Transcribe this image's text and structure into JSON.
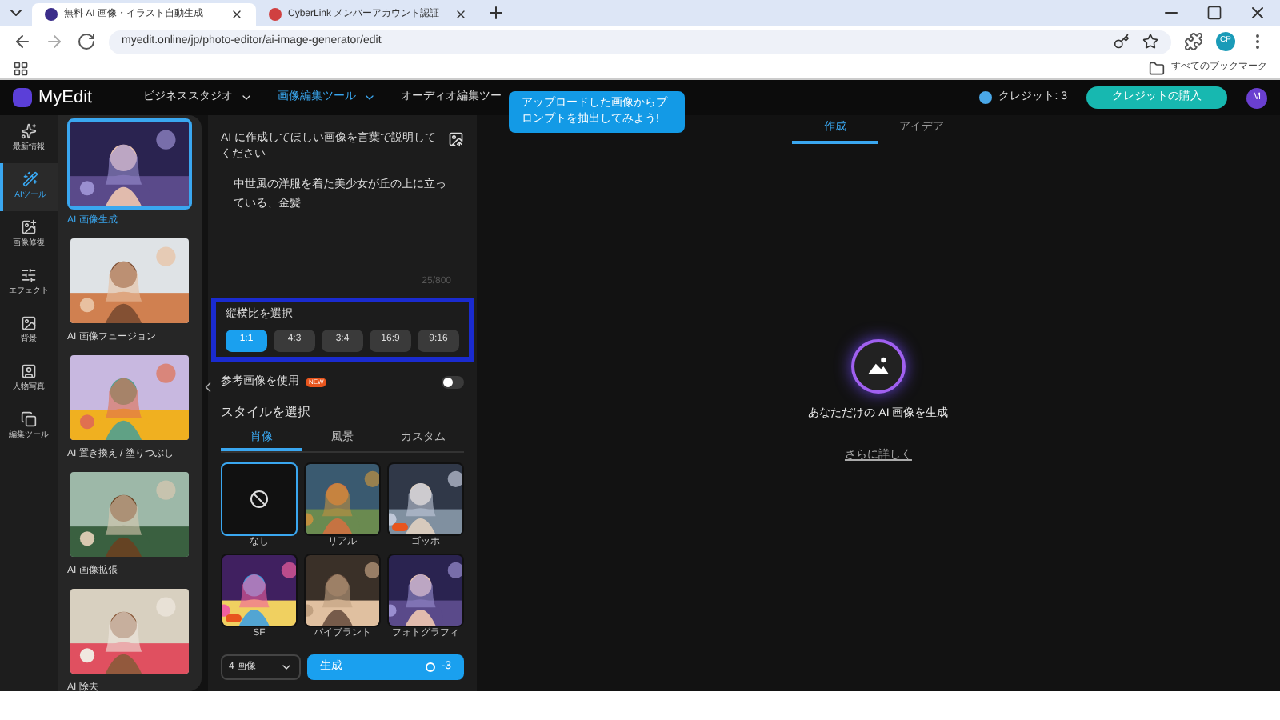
{
  "browser": {
    "tabs": [
      {
        "title": "無料 AI 画像・イラスト自動生成",
        "selected": true
      },
      {
        "title": "CyberLink メンバーアカウント認証",
        "selected": false
      }
    ],
    "url": "myedit.online/jp/photo-editor/ai-image-generator/edit",
    "bookmarks": "すべてのブックマーク",
    "profile": "CP"
  },
  "header": {
    "logo": "MyEdit",
    "nav": [
      {
        "label": "ビジネススタジオ",
        "selected": false
      },
      {
        "label": "画像編集ツール",
        "selected": true
      },
      {
        "label": "オーディオ編集ツー",
        "selected": false
      }
    ],
    "tooltip": "アップロードした画像からプロンプトを抽出してみよう!",
    "credits": "クレジット: 3",
    "buy": "クレジットの購入",
    "avatar": "M"
  },
  "rail": [
    {
      "label": "最新情報",
      "selected": false
    },
    {
      "label": "AIツール",
      "selected": true
    },
    {
      "label": "画像修復",
      "selected": false
    },
    {
      "label": "エフェクト",
      "selected": false
    },
    {
      "label": "背景",
      "selected": false
    },
    {
      "label": "人物写真",
      "selected": false
    },
    {
      "label": "編集ツール",
      "selected": false
    }
  ],
  "tools": [
    {
      "label": "AI 画像生成",
      "selected": true,
      "kind": "picture"
    },
    {
      "label": "AI 画像フュージョン",
      "selected": false,
      "kind": "picture"
    },
    {
      "label": "AI 置き換え / 塗りつぶし",
      "selected": false,
      "kind": "picture"
    },
    {
      "label": "AI 画像拡張",
      "selected": false,
      "kind": "picture"
    },
    {
      "label": "AI 除去",
      "selected": false,
      "kind": "picture"
    }
  ],
  "editor": {
    "prompt_label": "AI に作成してほしい画像を言葉で説明してください",
    "prompt": "中世風の洋服を着た美少女が丘の上に立っている、金髪",
    "count": "25/800",
    "ratio_label": "縦横比を選択",
    "ratios": [
      {
        "label": "1:1",
        "selected": true
      },
      {
        "label": "4:3",
        "selected": false
      },
      {
        "label": "3:4",
        "selected": false
      },
      {
        "label": "16:9",
        "selected": false
      },
      {
        "label": "9:16",
        "selected": false
      }
    ],
    "reference": {
      "label": "参考画像を使用",
      "badge": "NEW",
      "on": false
    },
    "style_label": "スタイルを選択",
    "style_tabs": [
      {
        "label": "肖像",
        "selected": true
      },
      {
        "label": "風景",
        "selected": false
      },
      {
        "label": "カスタム",
        "selected": false
      }
    ],
    "styles": [
      {
        "label": "なし",
        "kind": "none",
        "selected": true,
        "new": false
      },
      {
        "label": "リアル",
        "kind": "picture",
        "selected": false,
        "new": false
      },
      {
        "label": "ゴッホ",
        "kind": "picture",
        "selected": false,
        "new": true
      },
      {
        "label": "SF",
        "kind": "picture",
        "selected": false,
        "new": true
      },
      {
        "label": "バイブラント",
        "kind": "picture",
        "selected": false,
        "new": false
      },
      {
        "label": "フォトグラフィ",
        "kind": "picture",
        "selected": false,
        "new": false
      }
    ],
    "count_select": "4 画像",
    "generate": "生成",
    "cost": "-3"
  },
  "canvas": {
    "tabs": [
      {
        "label": "作成",
        "selected": true
      },
      {
        "label": "アイデア",
        "selected": false
      }
    ],
    "headline": "あなただけの AI 画像を生成",
    "link": "さらに詳しく"
  }
}
